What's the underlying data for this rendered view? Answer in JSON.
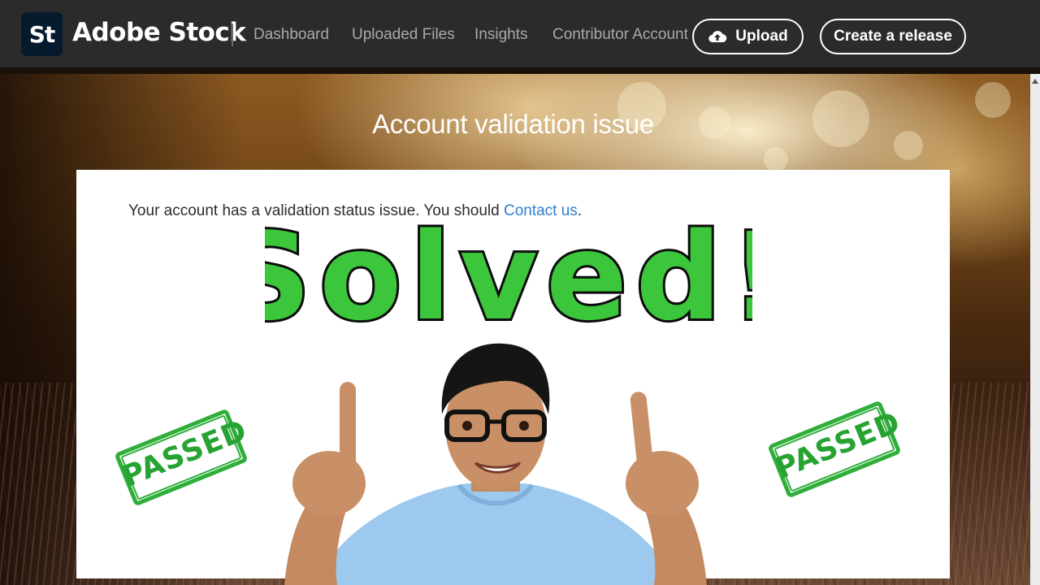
{
  "header": {
    "logo_short": "St",
    "brand": "Adobe Stock",
    "nav": [
      "Dashboard",
      "Uploaded Files",
      "Insights",
      "Contributor Account"
    ],
    "upload_label": "Upload",
    "create_release_label": "Create a release"
  },
  "hero": {
    "title": "Account validation issue"
  },
  "card": {
    "message": "Your account has a validation status issue. You should ",
    "link": "Contact us",
    "after_link": "."
  },
  "overlay": {
    "headline": "Solved!",
    "stamp_text": "PASSED"
  },
  "colors": {
    "accent_green": "#3cc63c",
    "link_blue": "#2d7fd0",
    "topbar": "#2b2b2b"
  }
}
